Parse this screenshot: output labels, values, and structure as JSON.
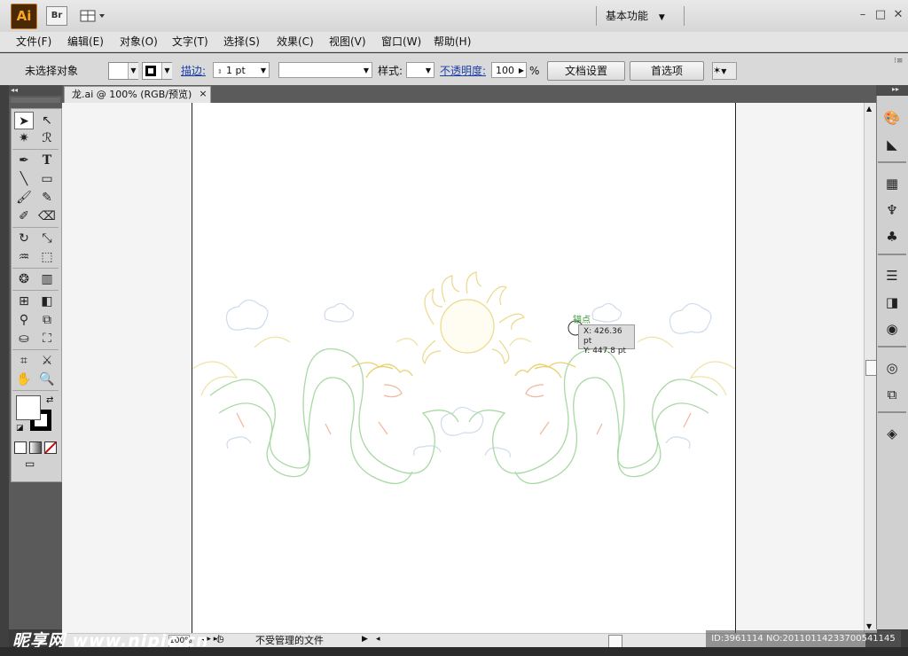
{
  "app": {
    "logo": "Ai",
    "bridge_label": "Br",
    "workspace": "基本功能"
  },
  "menu": [
    "文件(F)",
    "编辑(E)",
    "对象(O)",
    "文字(T)",
    "选择(S)",
    "效果(C)",
    "视图(V)",
    "窗口(W)",
    "帮助(H)"
  ],
  "control": {
    "selection_status": "未选择对象",
    "stroke_label": "描边:",
    "stroke_weight": "1 pt",
    "style_label": "样式:",
    "opacity_label": "不透明度:",
    "opacity_value": "100",
    "opacity_unit": "%",
    "doc_setup": "文档设置",
    "preferences": "首选项"
  },
  "document": {
    "tab_title": "龙.ai @ 100% (RGB/预览)",
    "close": "×"
  },
  "tooltip": {
    "x": "X: 426.36 pt",
    "y": "Y: 447.8 pt"
  },
  "cursor_label": "锚点",
  "status": {
    "zoom": "100%",
    "file_state": "不受管理的文件"
  },
  "watermarks": {
    "left": "昵享网 www.nipic.cn",
    "right": "ID:3961114 NO:20110114233700541145"
  },
  "colors": {
    "accent": "#f6a623",
    "dragon_green": "#8ecf8e",
    "dragon_gold": "#e8d26a",
    "cloud": "#c9d8ea"
  }
}
